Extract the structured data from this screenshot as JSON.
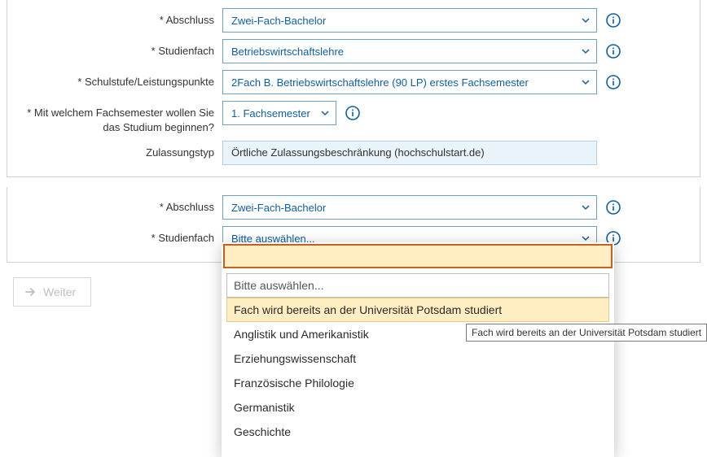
{
  "section1": {
    "abschluss": {
      "label": "* Abschluss",
      "value": "Zwei-Fach-Bachelor"
    },
    "studienfach": {
      "label": "* Studienfach",
      "value": "Betriebswirtschaftslehre"
    },
    "schulstufe": {
      "label": "* Schulstufe/Leistungspunkte",
      "value": "2Fach B. Betriebswirtschaftslehre (90 LP) erstes Fachsemester"
    },
    "fachsemester": {
      "label": "* Mit welchem Fachsemester wollen Sie das Studium beginnen?",
      "value": "1. Fachsemester"
    },
    "zulassungstyp": {
      "label": "Zulassungstyp",
      "value": "Örtliche Zulassungsbeschränkung (hochschulstart.de)"
    }
  },
  "section2": {
    "abschluss": {
      "label": "* Abschluss",
      "value": "Zwei-Fach-Bachelor"
    },
    "studienfach": {
      "label": "* Studienfach",
      "value": "Bitte auswählen..."
    }
  },
  "dropdown": {
    "search": "",
    "options": [
      {
        "text": "Bitte auswählen...",
        "placeholder": true
      },
      {
        "text": "Fach wird bereits an der Universität Potsdam studiert",
        "hover": true
      },
      {
        "text": "Anglistik und Amerikanistik"
      },
      {
        "text": "Erziehungswissenschaft"
      },
      {
        "text": "Französische Philologie"
      },
      {
        "text": "Germanistik"
      },
      {
        "text": "Geschichte"
      }
    ]
  },
  "tooltip": "Fach wird bereits an der Universität Potsdam studiert",
  "buttons": {
    "weiter": "Weiter"
  },
  "colors": {
    "accent": "#0e5fa6",
    "highlight_bg": "#ffeec2",
    "highlight_border": "#c65f1f"
  }
}
